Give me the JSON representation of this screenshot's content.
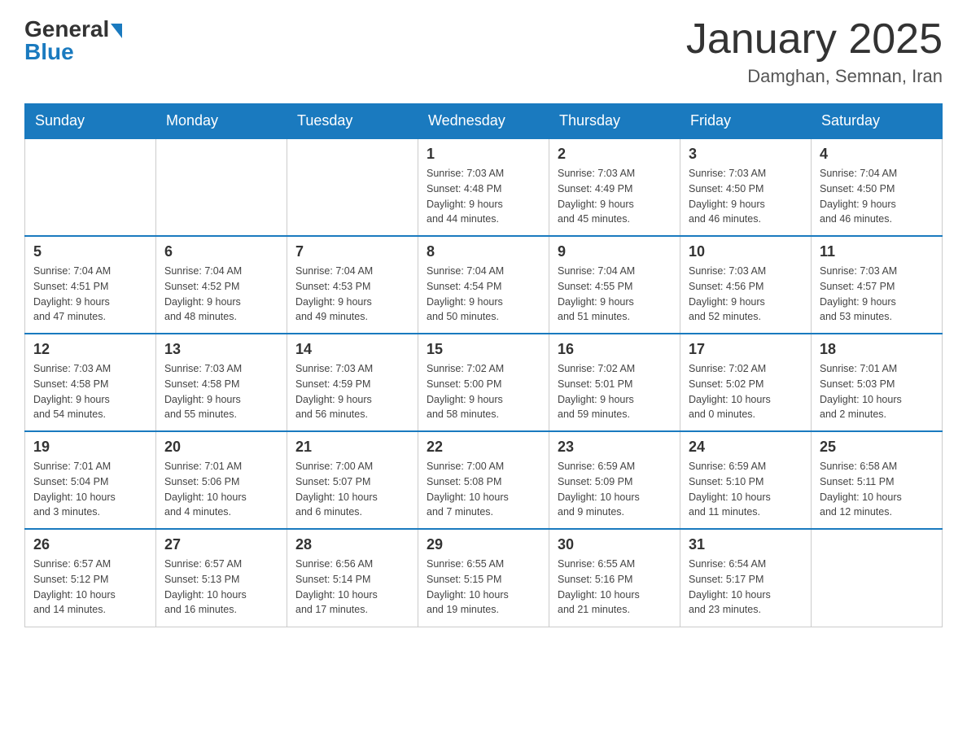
{
  "header": {
    "logo_general": "General",
    "logo_blue": "Blue",
    "month_title": "January 2025",
    "location": "Damghan, Semnan, Iran"
  },
  "days_of_week": [
    "Sunday",
    "Monday",
    "Tuesday",
    "Wednesday",
    "Thursday",
    "Friday",
    "Saturday"
  ],
  "weeks": [
    [
      {
        "day": "",
        "info": ""
      },
      {
        "day": "",
        "info": ""
      },
      {
        "day": "",
        "info": ""
      },
      {
        "day": "1",
        "info": "Sunrise: 7:03 AM\nSunset: 4:48 PM\nDaylight: 9 hours\nand 44 minutes."
      },
      {
        "day": "2",
        "info": "Sunrise: 7:03 AM\nSunset: 4:49 PM\nDaylight: 9 hours\nand 45 minutes."
      },
      {
        "day": "3",
        "info": "Sunrise: 7:03 AM\nSunset: 4:50 PM\nDaylight: 9 hours\nand 46 minutes."
      },
      {
        "day": "4",
        "info": "Sunrise: 7:04 AM\nSunset: 4:50 PM\nDaylight: 9 hours\nand 46 minutes."
      }
    ],
    [
      {
        "day": "5",
        "info": "Sunrise: 7:04 AM\nSunset: 4:51 PM\nDaylight: 9 hours\nand 47 minutes."
      },
      {
        "day": "6",
        "info": "Sunrise: 7:04 AM\nSunset: 4:52 PM\nDaylight: 9 hours\nand 48 minutes."
      },
      {
        "day": "7",
        "info": "Sunrise: 7:04 AM\nSunset: 4:53 PM\nDaylight: 9 hours\nand 49 minutes."
      },
      {
        "day": "8",
        "info": "Sunrise: 7:04 AM\nSunset: 4:54 PM\nDaylight: 9 hours\nand 50 minutes."
      },
      {
        "day": "9",
        "info": "Sunrise: 7:04 AM\nSunset: 4:55 PM\nDaylight: 9 hours\nand 51 minutes."
      },
      {
        "day": "10",
        "info": "Sunrise: 7:03 AM\nSunset: 4:56 PM\nDaylight: 9 hours\nand 52 minutes."
      },
      {
        "day": "11",
        "info": "Sunrise: 7:03 AM\nSunset: 4:57 PM\nDaylight: 9 hours\nand 53 minutes."
      }
    ],
    [
      {
        "day": "12",
        "info": "Sunrise: 7:03 AM\nSunset: 4:58 PM\nDaylight: 9 hours\nand 54 minutes."
      },
      {
        "day": "13",
        "info": "Sunrise: 7:03 AM\nSunset: 4:58 PM\nDaylight: 9 hours\nand 55 minutes."
      },
      {
        "day": "14",
        "info": "Sunrise: 7:03 AM\nSunset: 4:59 PM\nDaylight: 9 hours\nand 56 minutes."
      },
      {
        "day": "15",
        "info": "Sunrise: 7:02 AM\nSunset: 5:00 PM\nDaylight: 9 hours\nand 58 minutes."
      },
      {
        "day": "16",
        "info": "Sunrise: 7:02 AM\nSunset: 5:01 PM\nDaylight: 9 hours\nand 59 minutes."
      },
      {
        "day": "17",
        "info": "Sunrise: 7:02 AM\nSunset: 5:02 PM\nDaylight: 10 hours\nand 0 minutes."
      },
      {
        "day": "18",
        "info": "Sunrise: 7:01 AM\nSunset: 5:03 PM\nDaylight: 10 hours\nand 2 minutes."
      }
    ],
    [
      {
        "day": "19",
        "info": "Sunrise: 7:01 AM\nSunset: 5:04 PM\nDaylight: 10 hours\nand 3 minutes."
      },
      {
        "day": "20",
        "info": "Sunrise: 7:01 AM\nSunset: 5:06 PM\nDaylight: 10 hours\nand 4 minutes."
      },
      {
        "day": "21",
        "info": "Sunrise: 7:00 AM\nSunset: 5:07 PM\nDaylight: 10 hours\nand 6 minutes."
      },
      {
        "day": "22",
        "info": "Sunrise: 7:00 AM\nSunset: 5:08 PM\nDaylight: 10 hours\nand 7 minutes."
      },
      {
        "day": "23",
        "info": "Sunrise: 6:59 AM\nSunset: 5:09 PM\nDaylight: 10 hours\nand 9 minutes."
      },
      {
        "day": "24",
        "info": "Sunrise: 6:59 AM\nSunset: 5:10 PM\nDaylight: 10 hours\nand 11 minutes."
      },
      {
        "day": "25",
        "info": "Sunrise: 6:58 AM\nSunset: 5:11 PM\nDaylight: 10 hours\nand 12 minutes."
      }
    ],
    [
      {
        "day": "26",
        "info": "Sunrise: 6:57 AM\nSunset: 5:12 PM\nDaylight: 10 hours\nand 14 minutes."
      },
      {
        "day": "27",
        "info": "Sunrise: 6:57 AM\nSunset: 5:13 PM\nDaylight: 10 hours\nand 16 minutes."
      },
      {
        "day": "28",
        "info": "Sunrise: 6:56 AM\nSunset: 5:14 PM\nDaylight: 10 hours\nand 17 minutes."
      },
      {
        "day": "29",
        "info": "Sunrise: 6:55 AM\nSunset: 5:15 PM\nDaylight: 10 hours\nand 19 minutes."
      },
      {
        "day": "30",
        "info": "Sunrise: 6:55 AM\nSunset: 5:16 PM\nDaylight: 10 hours\nand 21 minutes."
      },
      {
        "day": "31",
        "info": "Sunrise: 6:54 AM\nSunset: 5:17 PM\nDaylight: 10 hours\nand 23 minutes."
      },
      {
        "day": "",
        "info": ""
      }
    ]
  ]
}
